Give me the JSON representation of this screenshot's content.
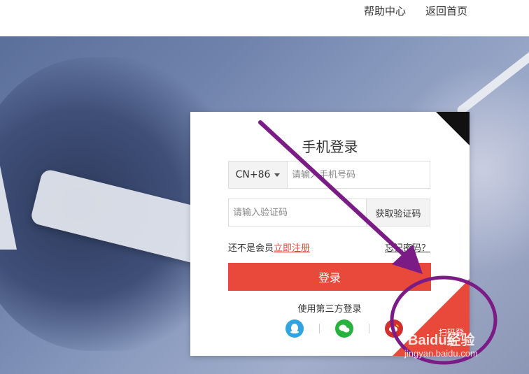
{
  "header": {
    "help_label": "帮助中心",
    "home_label": "返回首页"
  },
  "login": {
    "title": "手机登录",
    "country_code": "CN+86",
    "phone_placeholder": "请输入手机号码",
    "code_placeholder": "请输入验证码",
    "get_code_label": "获取验证码",
    "not_member_text": "还不是会员",
    "register_label": "立即注册",
    "forgot_label": "忘记密码？",
    "login_button_label": "登录",
    "third_party_label": "使用第三方登录",
    "corner_text": "扫码登录",
    "socials": [
      {
        "name": "qq-icon"
      },
      {
        "name": "wechat-icon"
      },
      {
        "name": "weibo-icon"
      }
    ]
  },
  "watermark": {
    "brand": "Baidu经验",
    "url": "jingyan.baidu.com"
  },
  "colors": {
    "accent": "#e8493a",
    "annotation": "#7a1b86"
  }
}
